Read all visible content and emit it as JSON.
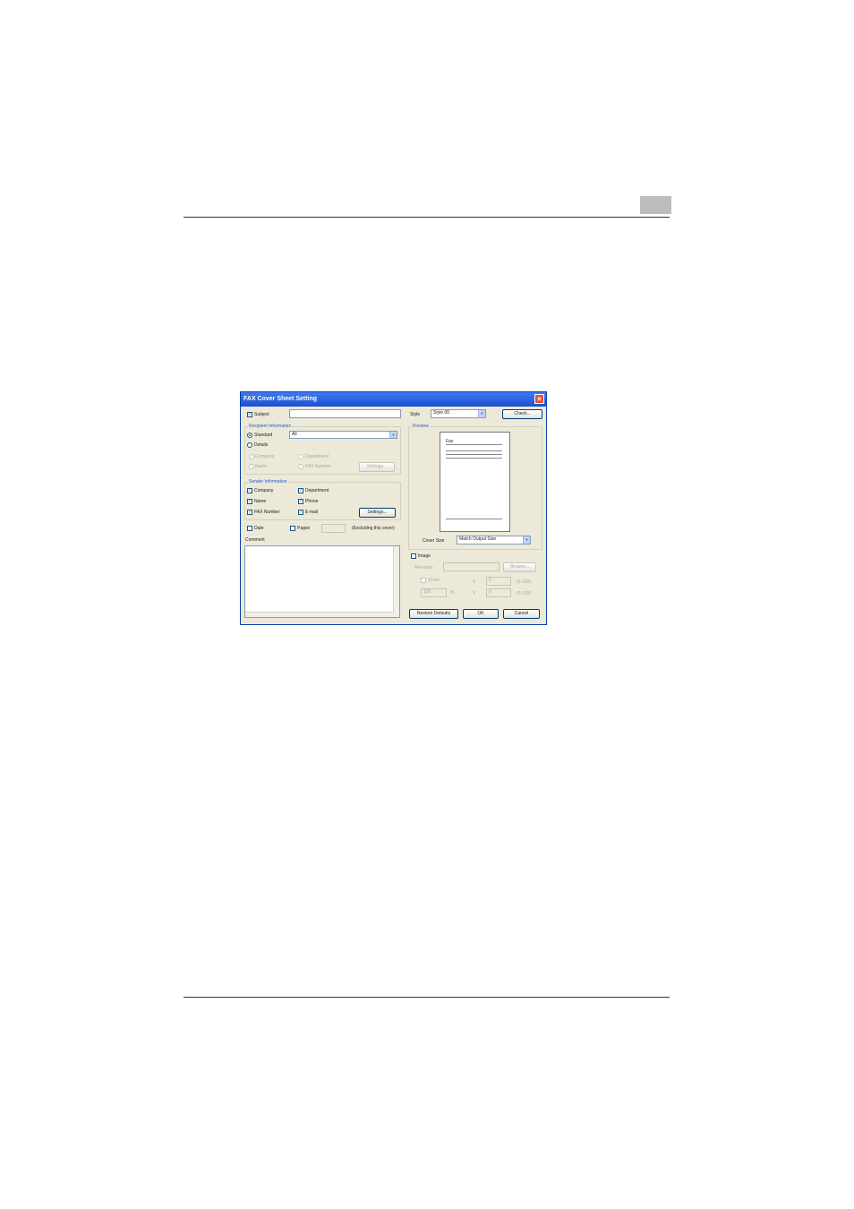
{
  "dialog": {
    "title": "FAX Cover Sheet Setting",
    "subject": {
      "label": "Subject",
      "checked": true,
      "value": ""
    },
    "recipient": {
      "group_label": "Recipient Information",
      "standard_label": "Standard",
      "standard_value": "All",
      "details_label": "Details",
      "company_label": "Company",
      "department_label": "Department",
      "name_label": "Name",
      "fax_number_label": "FAX Number",
      "settings_label": "Settings..."
    },
    "sender": {
      "group_label": "Sender Information",
      "company_label": "Company",
      "department_label": "Department",
      "name_label": "Name",
      "phone_label": "Phone",
      "fax_number_label": "FAX Number",
      "email_label": "E-mail",
      "settings_label": "Settings..."
    },
    "date_label": "Date",
    "pages_label": "Pages",
    "excluding_label": "(Excluding this cover)",
    "comment_label": "Comment",
    "style": {
      "label": "Style",
      "value": "Style 00",
      "check_label": "Check..."
    },
    "preview": {
      "label": "Preview",
      "fax_text": "Fax"
    },
    "cover_size": {
      "label": "Cover Size",
      "value": "Match Output Size"
    },
    "image": {
      "label": "Image",
      "filename_label": "Filename",
      "browse_label": "Browse...",
      "zoom_label": "Zoom",
      "zoom_value": "100",
      "x_label": "X",
      "y_label": "Y",
      "x_value": "0",
      "y_value": "0",
      "x_range": "(0-100)",
      "y_range": "(0-100)"
    },
    "buttons": {
      "restore": "Restore Defaults",
      "ok": "OK",
      "cancel": "Cancel"
    }
  }
}
